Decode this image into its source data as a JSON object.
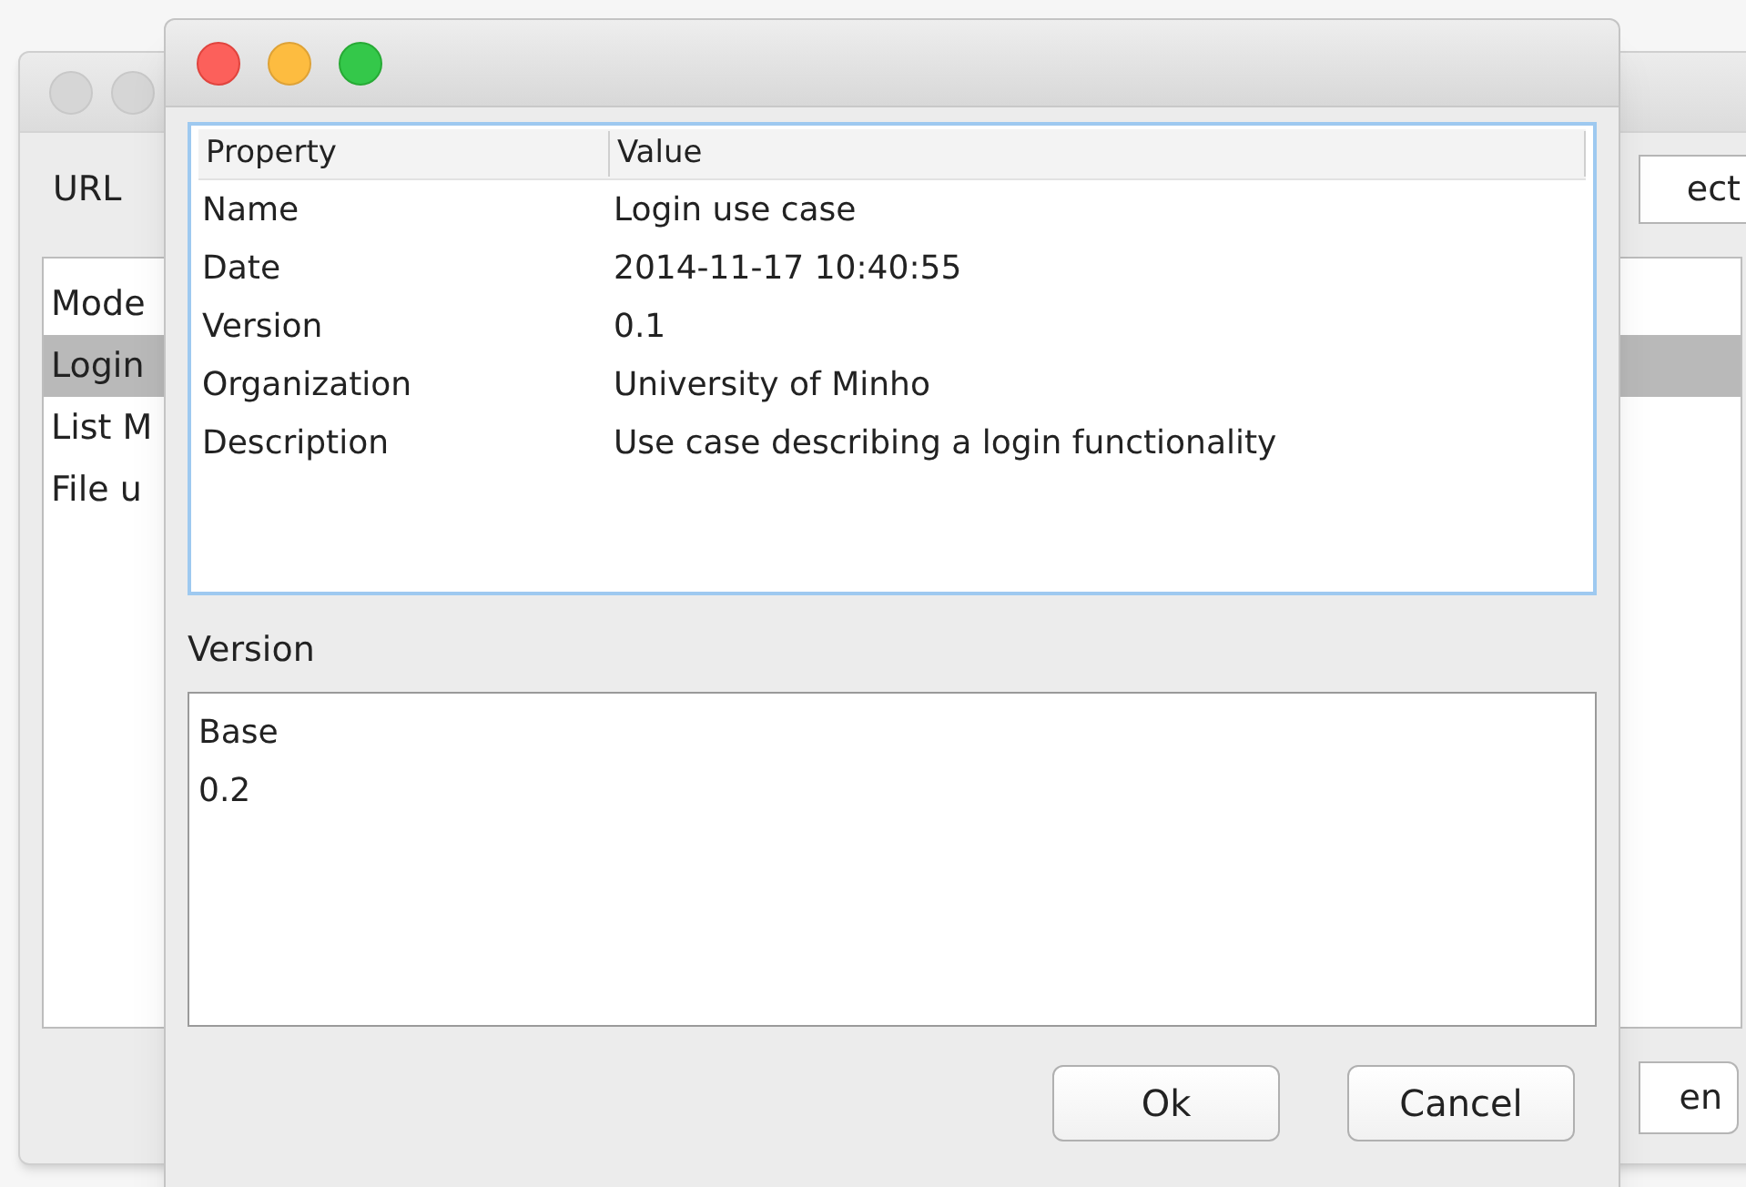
{
  "background_window": {
    "url_label": "URL",
    "top_button": "ect",
    "list_items": [
      {
        "label": "Mode",
        "selected": false
      },
      {
        "label": "Login",
        "selected": true
      },
      {
        "label": "List M",
        "selected": false
      },
      {
        "label": "File u",
        "selected": false
      }
    ],
    "bottom_button": "en"
  },
  "dialog": {
    "table": {
      "columns": [
        "Property",
        "Value"
      ],
      "rows": [
        {
          "property": "Name",
          "value": "Login use case"
        },
        {
          "property": "Date",
          "value": "2014-11-17 10:40:55"
        },
        {
          "property": "Version",
          "value": "0.1"
        },
        {
          "property": "Organization",
          "value": "University of Minho"
        },
        {
          "property": "Description",
          "value": "Use case describing a login functionality"
        }
      ]
    },
    "versions_label": "Version",
    "versions": [
      "Base",
      "0.2"
    ],
    "buttons": [
      "Ok",
      "Cancel"
    ]
  }
}
